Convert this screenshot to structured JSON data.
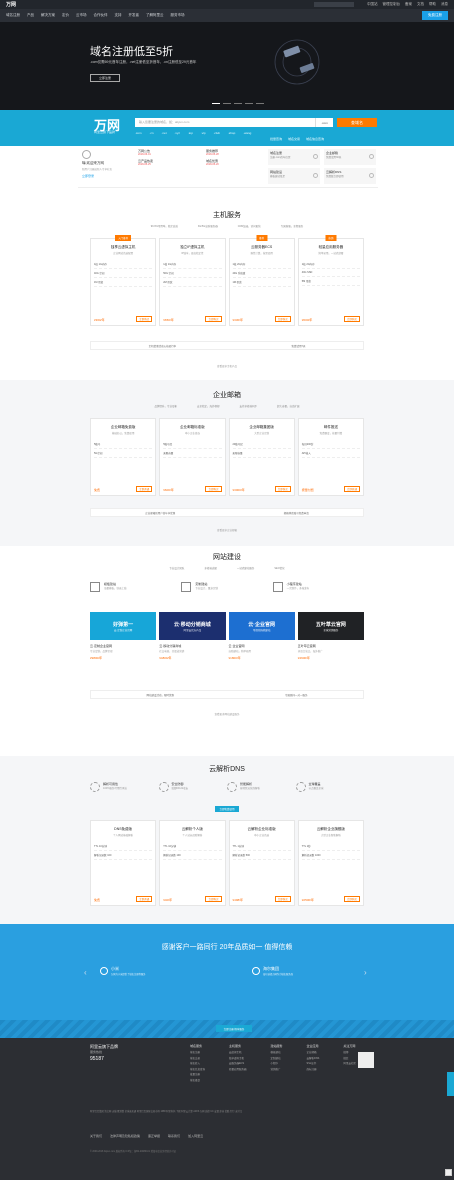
{
  "topbar": {
    "logo": "万网",
    "search_placeholder": "搜索",
    "links": [
      "中国站",
      "管理控制台",
      "备案",
      "文档",
      "帮助",
      "消息"
    ]
  },
  "nav": {
    "items": [
      "域名注册",
      "产品",
      "解决方案",
      "定价",
      "云市场",
      "合作伙伴",
      "支持",
      "开发者",
      "了解阿里云",
      "服务市场"
    ],
    "cta": "免费注册"
  },
  "hero": {
    "title": "域名注册低至5折",
    "subtitle": ".com仅需69元首年注册，.net注册低至折首年，.cn注册低至29元首年",
    "button": "立即注册"
  },
  "brandbar": {
    "brand": "万网",
    "slogan": "阿里云旗下品牌",
    "search_placeholder": "输入您要注册的域名，如：aliyun.com",
    "suffix_select": ".com",
    "search_button": "查域名",
    "tlds": [
      ".com",
      ".cn",
      ".net",
      ".xyz",
      ".top",
      ".vip",
      ".club",
      ".shop",
      ".wang"
    ],
    "quick_links": [
      "批量查询",
      "域名交易",
      "域名信息查询"
    ]
  },
  "quick": {
    "user_title": "嗨,欢迎来万网",
    "user_desc": "新用户注册送新人专享礼包",
    "login": "立即登录",
    "news": [
      {
        "title": "万网公告",
        "date": "2018-06-01"
      },
      {
        "title": "服务推荐",
        "date": "2018-05-28"
      },
      {
        "title": "云产品热卖",
        "date": "2018-05-25"
      },
      {
        "title": "域名优惠",
        "date": "2018-05-20"
      }
    ],
    "promos": [
      {
        "title": "域名注册",
        "desc": "注册.com首年仅需"
      },
      {
        "title": "企业邮箱",
        "desc": "免费试用30天"
      },
      {
        "title": "网站建设",
        "desc": "模板建站低至"
      },
      {
        "title": "云解析DNS",
        "desc": "免费版立即使用"
      }
    ]
  },
  "host": {
    "title": "主机服务",
    "features": [
      "99.9%可用率，稳定高效",
      "3G/5G高防服务器",
      "CDN加速，访问更快",
      "专属客服，全程服务"
    ],
    "cards": [
      {
        "tag": "入门推荐",
        "title": "独享云虚拟主机",
        "desc": "企业网站首选配置",
        "rows": [
          "1核 1G内存",
          "40G 空间",
          "1M 带宽"
        ],
        "price": "¥360/年",
        "buy": "立即购买"
      },
      {
        "tag": "",
        "title": "独立IP虚拟主机",
        "desc": "IP独享，更高稳定性",
        "rows": [
          "1核 1G内存",
          "50G 空间",
          "2M 带宽"
        ],
        "price": "¥650/年",
        "buy": "立即购买"
      },
      {
        "tag": "推荐",
        "title": "云服务器ECS",
        "desc": "弹性计算，按需使用",
        "rows": [
          "1核 2G内存",
          "40G 系统盘",
          "1M 带宽"
        ],
        "price": "¥330/年",
        "buy": "立即购买"
      },
      {
        "tag": "热销",
        "title": "轻量应用服务器",
        "desc": "简单易用，一站式部署",
        "rows": [
          "1核 2G内存",
          "40G SSD",
          "5M 带宽"
        ],
        "price": "¥600/年",
        "buy": "立即购买"
      }
    ],
    "notes": [
      "主机优惠活动火热进行中",
      "免费试用7天"
    ],
    "more": "查看更多主机产品"
  },
  "mail": {
    "title": "企业邮箱",
    "features": [
      "品牌提升，专业形象",
      "安全稳定，海外畅邮",
      "支持多终端同步",
      "超大容量，自由扩展"
    ],
    "cards": [
      {
        "tag": "",
        "title": "企业邮箱免费版",
        "desc": "基础办公，免费使用",
        "rows": [
          "5账号",
          "5G空间"
        ],
        "price": "免费",
        "buy": "立即开通"
      },
      {
        "tag": "",
        "title": "企业邮箱标准版",
        "desc": "中小企业首选",
        "rows": [
          "5账号起",
          "无限容量"
        ],
        "price": "¥600/年",
        "buy": "立即购买"
      },
      {
        "tag": "",
        "title": "企业邮箱集团版",
        "desc": "大型企业定制",
        "rows": [
          "20账号起",
          "无限容量"
        ],
        "price": "¥3000/年",
        "buy": "立即购买"
      },
      {
        "tag": "",
        "title": "邮件推送",
        "desc": "免费额度，按量付费",
        "rows": [
          "每日200封",
          "API接入"
        ],
        "price": "按量付费",
        "buy": "立即开通"
      }
    ],
    "notes": [
      "企业邮箱新用户首年享优惠",
      "邮箱体验账号免费申请"
    ],
    "more": "查看更多企业邮箱"
  },
  "web": {
    "title": "网站建设",
    "features": [
      "专业设计团队",
      "多终端适配",
      "一站式建站服务",
      "SEO优化"
    ],
    "top": [
      {
        "title": "模板建站",
        "desc": "海量模板，快速上线"
      },
      {
        "title": "定制建站",
        "desc": "专业设计，量身定制"
      },
      {
        "title": "小程序建站",
        "desc": "一次制作，多端发布"
      }
    ],
    "banners": [
      {
        "title": "好弹第一",
        "sub": "云·定制企业官网"
      },
      {
        "title": "云·移动分销商城",
        "sub": "阿里云官方产品"
      },
      {
        "title": "云·企业官网",
        "sub": "可视化拖拽建站"
      },
      {
        "title": "五叶草云官网",
        "sub": "全球营销服务"
      }
    ],
    "items": [
      {
        "title": "云·定制企业官网",
        "desc": "专业定制，品牌呈现",
        "price": "¥9800/年"
      },
      {
        "title": "云·移动分销商城",
        "desc": "社交电商，全渠道营销",
        "price": "¥4800/年"
      },
      {
        "title": "云·企业官网",
        "desc": "自助建站，简单易用",
        "price": "¥1800/年"
      },
      {
        "title": "五叶草云官网",
        "desc": "多语言站点，海外推广",
        "price": "¥4600/年"
      }
    ],
    "notes": [
      "网站建设活动，限时优惠",
      "专属顾问一对一服务"
    ],
    "more": "查看更多网站建设服务"
  },
  "dns": {
    "title": "云解析DNS",
    "features": [
      {
        "title": "解析可用性",
        "desc": "100%服务可用性承诺"
      },
      {
        "title": "安全防御",
        "desc": "抵御DDoS攻击"
      },
      {
        "title": "智能解析",
        "desc": "按地区运营商解析"
      },
      {
        "title": "全球覆盖",
        "desc": "节点覆盖全球"
      }
    ],
    "button": "立即免费使用",
    "cards": [
      {
        "tag": "",
        "title": "DNS免费版",
        "desc": "个人网站基础解析",
        "rows": [
          "TTL 10分钟",
          "解析记录数 100"
        ],
        "price": "免费",
        "buy": "立即开通"
      },
      {
        "tag": "",
        "title": "云解析个人版",
        "desc": "个人站长进阶解析",
        "rows": [
          "TTL 10分钟",
          "解析记录数 100"
        ],
        "price": "¥40/年",
        "buy": "立即购买"
      },
      {
        "tag": "",
        "title": "云解析企业标准版",
        "desc": "中小企业首选",
        "rows": [
          "TTL 1分钟",
          "解析记录数 500"
        ],
        "price": "¥498/年",
        "buy": "立即购买"
      },
      {
        "tag": "",
        "title": "云解析企业旗舰版",
        "desc": "大型企业智能解析",
        "rows": [
          "TTL 1秒",
          "解析记录数 1000"
        ],
        "price": "¥2500/年",
        "buy": "立即购买"
      }
    ]
  },
  "bigblue": {
    "title": "感谢客户一路同行 20年品质如一 值得信赖",
    "logos": [
      {
        "name": "小米",
        "desc": "万网为小米提供了域名注册等服务"
      },
      {
        "name": "海尔集团",
        "desc": "海尔选择万网作为域名服务商"
      }
    ],
    "button": "立即注册 畅享服务"
  },
  "footer": {
    "brand": "阿里云旗下品牌",
    "tel_label": "服务热线",
    "tel": "95187",
    "cols": [
      {
        "title": "域名服务",
        "items": [
          "域名注册",
          "域名交易",
          "域名转入",
          "域名信息查询",
          "批量注册",
          "域名备案"
        ]
      },
      {
        "title": "主机服务",
        "items": [
          "云虚拟主机",
          "独享虚拟主机",
          "云服务器ECS",
          "轻量应用服务器"
        ]
      },
      {
        "title": "建站服务",
        "items": [
          "模板建站",
          "定制建站",
          "小程序",
          "营销推广"
        ]
      },
      {
        "title": "企业应用",
        "items": [
          "企业邮箱",
          "云解析DNS",
          "SSL证书",
          "商标注册"
        ]
      },
      {
        "title": "关注万网",
        "items": [
          "微博",
          "微信",
          "阿里云社区"
        ]
      }
    ],
    "links": "阿里巴巴集团 淘宝网 天猫 聚划算 全球速卖通 阿里巴巴国际交易市场 1688 阿里妈妈 飞猪 阿里云计算 AliOS 万网 高德 UC 友盟 虾米 优酷 钉钉 支付宝",
    "bottom": [
      "关于我们",
      "法律声明及隐私权政策",
      "廉正举报",
      "联系我们",
      "加入阿里云"
    ],
    "copy": "© 2009-2018 Aliyun.com 版权所有 ICP证：浙B2-20080101 增值电信业务经营许可证"
  }
}
